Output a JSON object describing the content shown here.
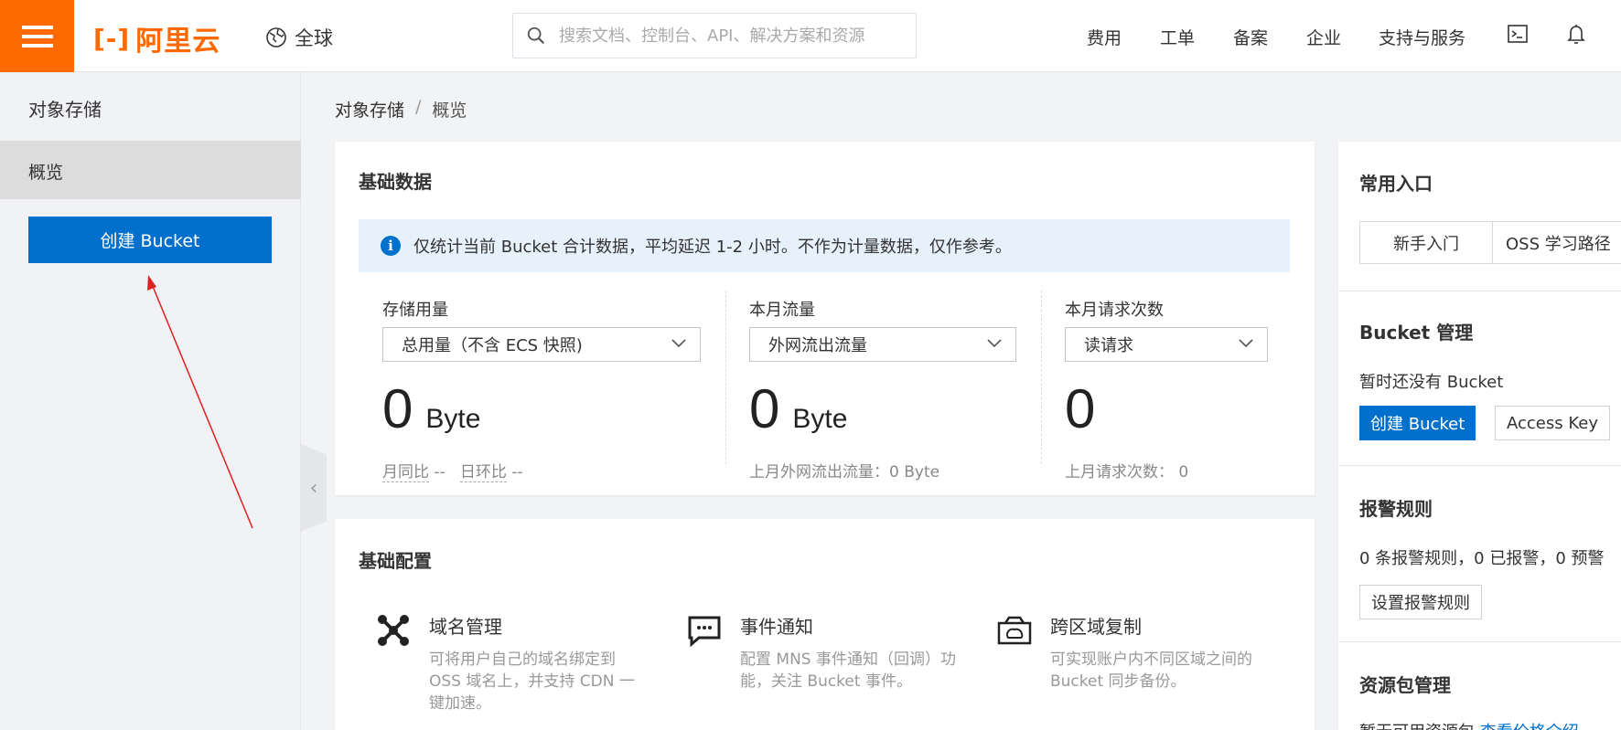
{
  "header": {
    "logo_text": "阿里云",
    "logo_mark": "[-]",
    "region": "全球",
    "search_placeholder": "搜索文档、控制台、API、解决方案和资源",
    "nav": [
      "费用",
      "工单",
      "备案",
      "企业",
      "支持与服务"
    ]
  },
  "sidebar": {
    "title": "对象存储",
    "active_item": "概览",
    "create_button": "创建 Bucket"
  },
  "breadcrumb": {
    "root": "对象存储",
    "separator": "/",
    "current": "概览"
  },
  "basic_data": {
    "title": "基础数据",
    "info": "仅统计当前 Bucket 合计数据，平均延迟 1-2 小时。不作为计量数据，仅作参考。",
    "storage": {
      "label": "存储用量",
      "select": "总用量（不含 ECS 快照)",
      "value": "0",
      "unit": "Byte",
      "sub_yoy": "月同比",
      "sub_yoy_val": "--",
      "sub_mom": "日环比",
      "sub_mom_val": "--"
    },
    "traffic": {
      "label": "本月流量",
      "select": "外网流出流量",
      "value": "0",
      "unit": "Byte",
      "sub": "上月外网流出流量：0 Byte"
    },
    "requests": {
      "label": "本月请求次数",
      "select": "读请求",
      "value": "0",
      "sub": "上月请求次数：  0"
    }
  },
  "basic_config": {
    "title": "基础配置",
    "features": [
      {
        "name": "域名管理",
        "desc": "可将用户自己的域名绑定到 OSS 域名上，并支持 CDN 一键加速。"
      },
      {
        "name": "事件通知",
        "desc": "配置 MNS 事件通知（回调）功能，关注 Bucket 事件。"
      },
      {
        "name": "跨区域复制",
        "desc": "可实现账户内不同区域之间的 Bucket 同步备份。"
      }
    ]
  },
  "right": {
    "common_title": "常用入口",
    "tabs": [
      "新手入门",
      "OSS 学习路径"
    ],
    "bucket_title": "Bucket 管理",
    "bucket_empty": "暂时还没有 Bucket",
    "bucket_create": "创建 Bucket",
    "access_key": "Access Key",
    "alarm_title": "报警规则",
    "alarm_text": "0 条报警规则，0 已报警，0 预警",
    "alarm_button": "设置报警规则",
    "resource_title": "资源包管理",
    "resource_text": "暂无可用资源包",
    "resource_link": "查看价格介绍"
  },
  "colors": {
    "brand_orange": "#ff6a00",
    "primary_blue": "#0070cc",
    "annotation_red": "#e02020"
  }
}
